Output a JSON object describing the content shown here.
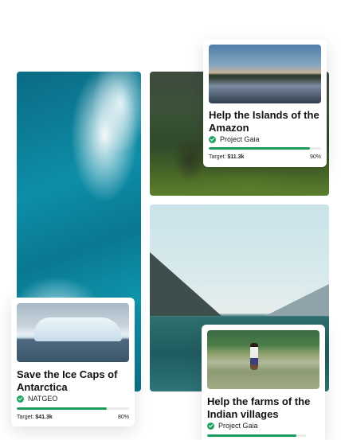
{
  "cards": [
    {
      "title": "Help the Islands of the Amazon",
      "org": "Project Gaia",
      "target_label": "Target:",
      "target_value": "$11.3k",
      "progress_label": "90%",
      "progress": 0.9
    },
    {
      "title": "Save the Ice Caps of Antarctica",
      "org": "NATGEO",
      "target_label": "Target:",
      "target_value": "$41.3k",
      "progress_label": "80%",
      "progress": 0.8
    },
    {
      "title": "Help the farms of the Indian villages",
      "org": "Project Gaia",
      "progress": 0.9
    }
  ],
  "colors": {
    "accent": "#1c9c5c",
    "verified": "#21a464",
    "track": "#e7ece9"
  },
  "icons": {
    "verified": "check-circle-icon"
  }
}
